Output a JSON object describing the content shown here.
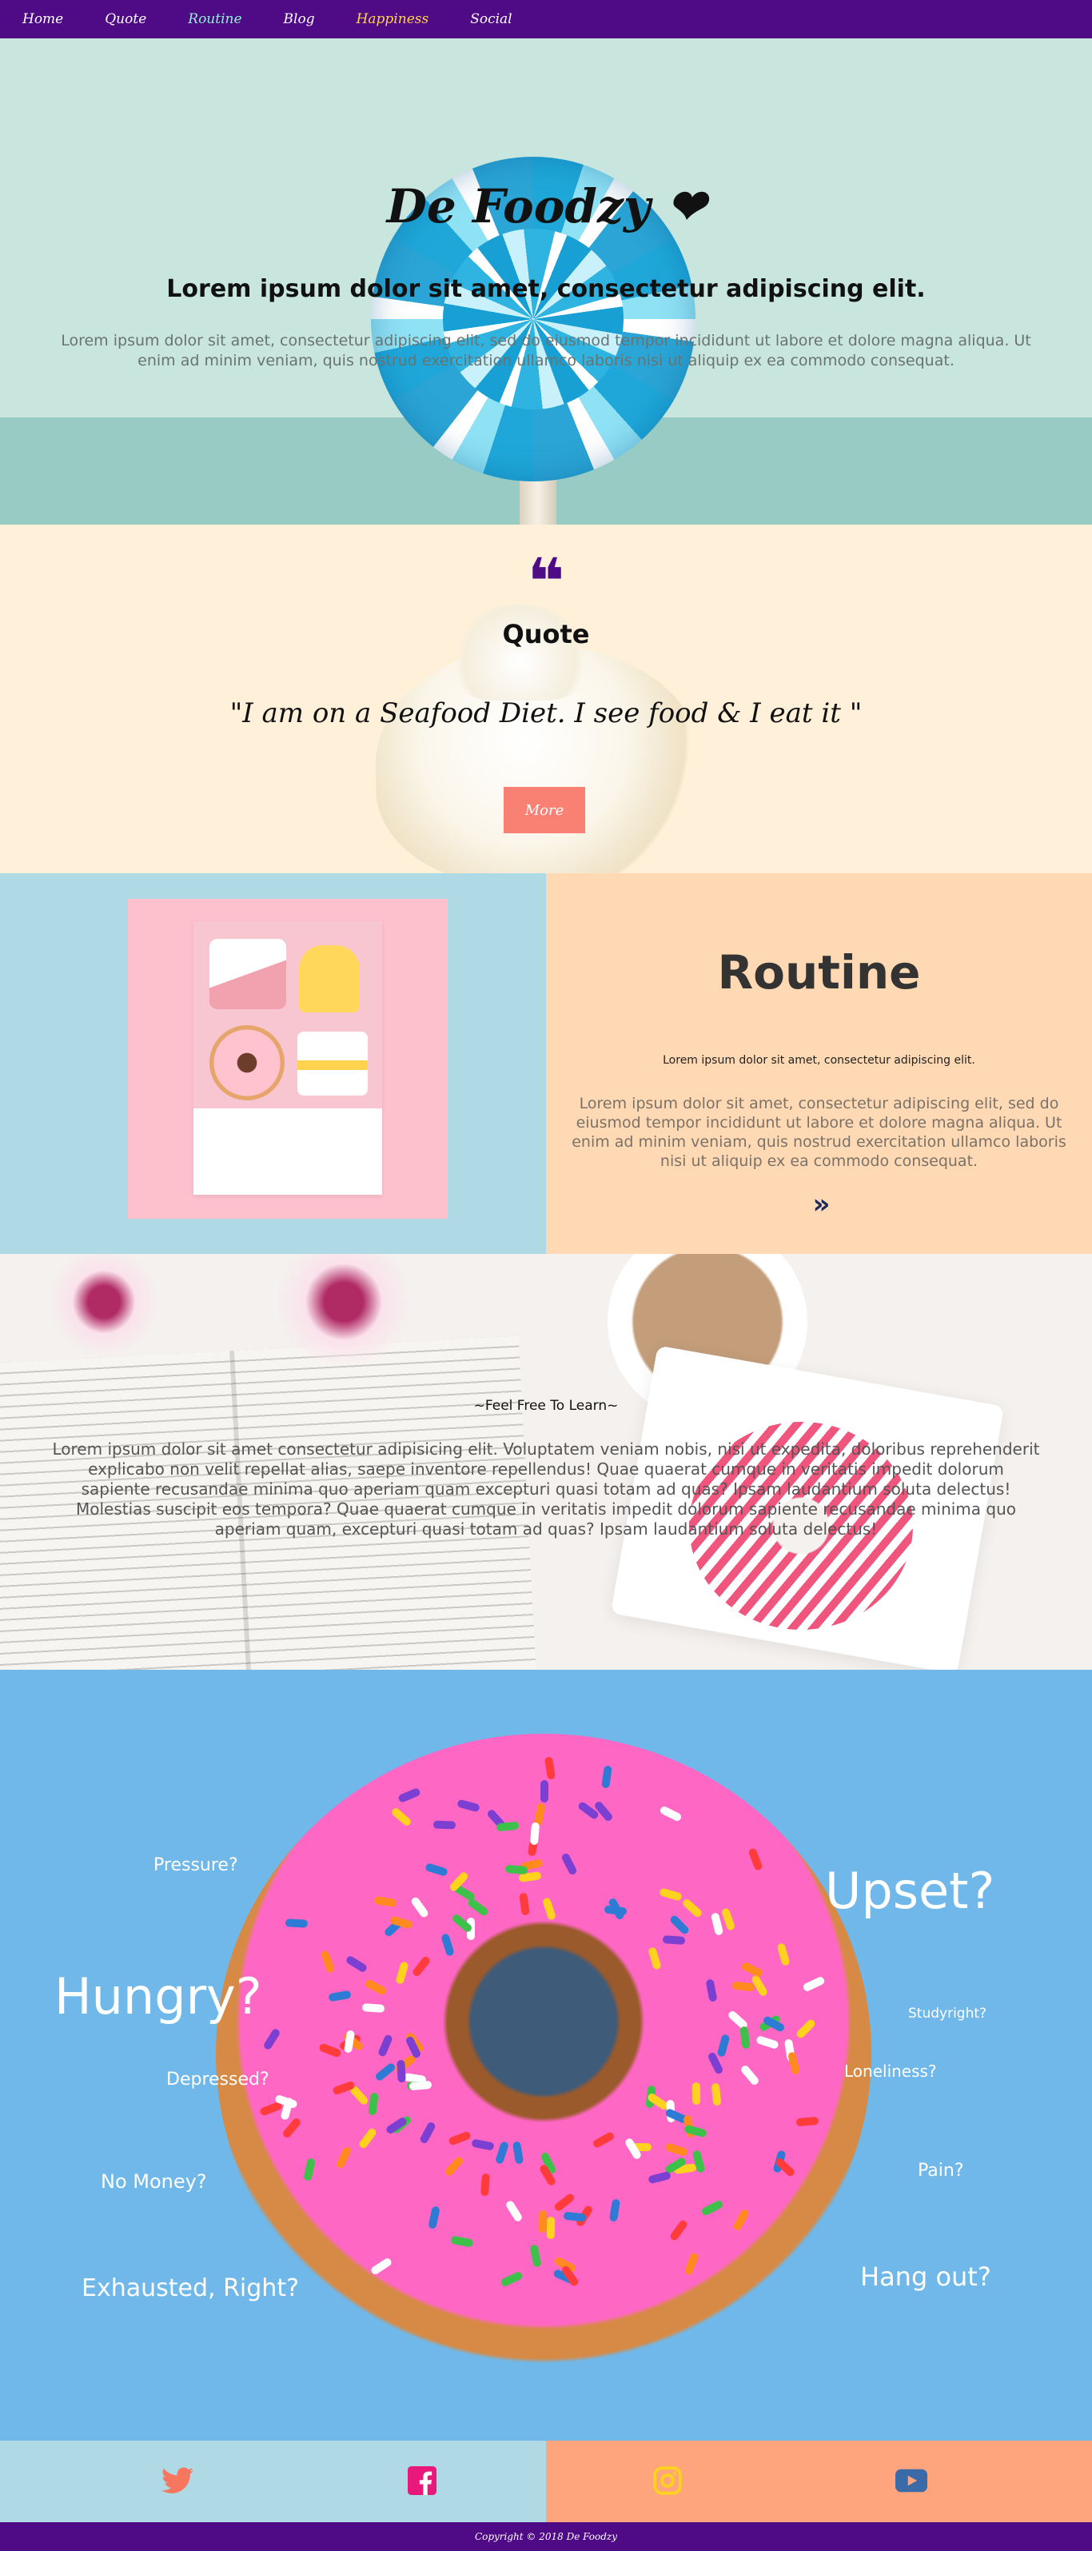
{
  "nav": {
    "items": [
      "Home",
      "Quote",
      "Routine",
      "Blog",
      "Happiness",
      "Social"
    ]
  },
  "hero": {
    "title": "De Foodzy ❤",
    "subtitle": "Lorem ipsum dolor sit amet, consectetur adipiscing elit.",
    "paragraph": "Lorem ipsum dolor sit amet, consectetur adipiscing elit, sed do eiusmod tempor incididunt ut labore et dolore magna aliqua. Ut enim ad minim veniam, quis nostrud exercitation ullamco laboris nisi ut aliquip ex ea commodo consequat."
  },
  "quote": {
    "icon": "❝",
    "heading": "Quote",
    "text": "\"I am on a Seafood Diet. I see food & I eat it \"",
    "button": "More"
  },
  "routine": {
    "heading": "Routine",
    "subtitle": "Lorem ipsum dolor sit amet, consectetur adipiscing elit.",
    "paragraph": "Lorem ipsum dolor sit amet, consectetur adipiscing elit, sed do eiusmod tempor incididunt ut labore et dolore magna aliqua. Ut enim ad minim veniam, quis nostrud exercitation ullamco laboris nisi ut aliquip ex ea commodo consequat.",
    "chevron": "»"
  },
  "learn": {
    "tagline": "~Feel Free To Learn~",
    "paragraph": "Lorem ipsum dolor sit amet consectetur adipisicing elit. Voluptatem veniam nobis, nisi ut expedita, doloribus reprehenderit explicabo non velit repellat alias, saepe inventore repellendus! Quae quaerat cumque in veritatis impedit dolorum sapiente recusandae minima quo aperiam quam excepturi quasi totam ad quas? Ipsam laudantium soluta delectus! Molestias suscipit eos tempora? Quae quaerat cumque in veritatis impedit dolorum sapiente recusandae minima quo aperiam quam, excepturi quasi totam ad quas? Ipsam laudantium soluta delectus!"
  },
  "happiness": {
    "words": [
      "Pressure?",
      "Upset?",
      "Hungry?",
      "Studyright?",
      "Depressed?",
      "Loneliness?",
      "No Money?",
      "Pain?",
      "Exhausted, Right?",
      "Hang out?"
    ]
  },
  "social": {
    "icons": [
      "twitter-icon",
      "facebook-icon",
      "instagram-icon",
      "youtube-icon"
    ]
  },
  "footer": {
    "text": "Copyright © 2018 De Foodzy"
  },
  "colors": {
    "nav": "#4f0a86",
    "accent": "#f98174",
    "mint": "#c8e6de",
    "cream": "#fff0d9",
    "blue": "#aed9e5",
    "peach": "#ffd9b3",
    "sky": "#6fb8e9",
    "orange": "#ffa57d"
  }
}
